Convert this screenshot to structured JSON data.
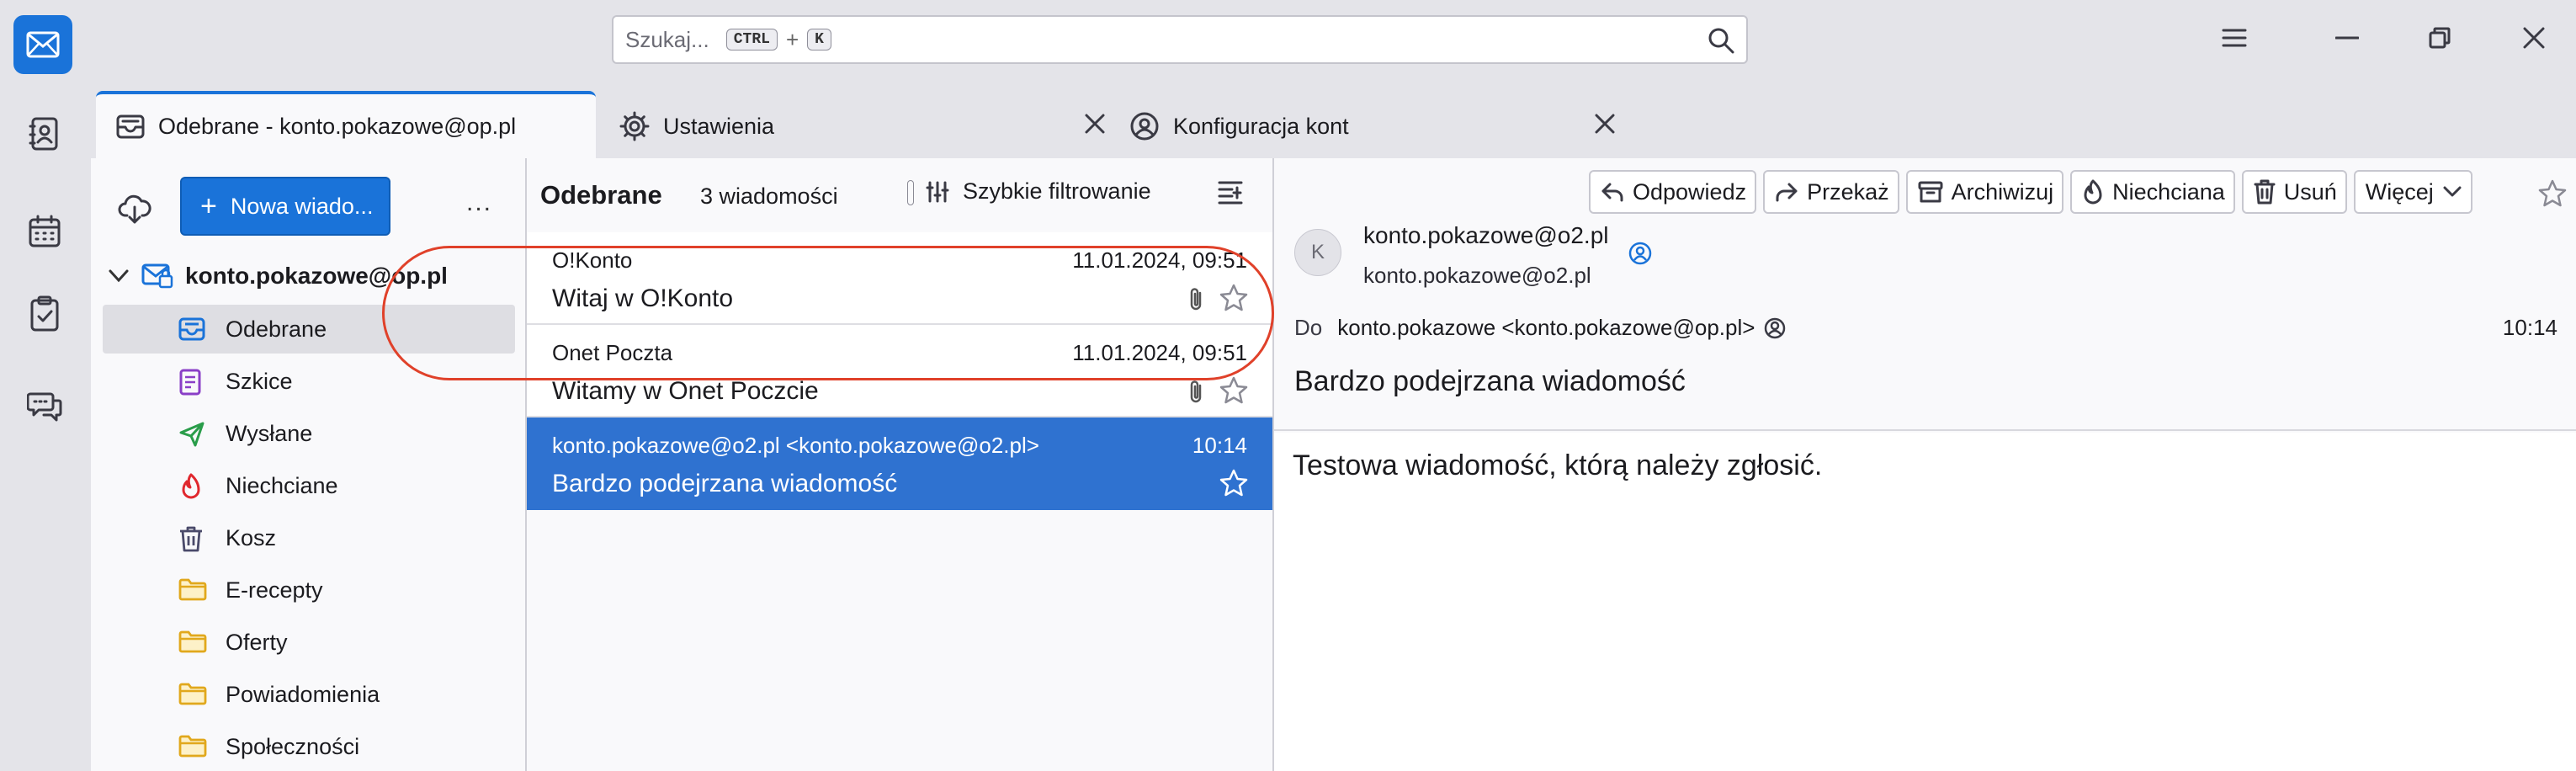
{
  "search": {
    "placeholder": "Szukaj...",
    "key1": "CTRL",
    "plus": "+",
    "key2": "K"
  },
  "tabs": [
    {
      "label": "Odebrane - konto.pokazowe@op.pl"
    },
    {
      "label": "Ustawienia"
    },
    {
      "label": "Konfiguracja kont"
    }
  ],
  "folder_pane": {
    "new_message": "Nowa wiado...",
    "more": "...",
    "account": "konto.pokazowe@op.pl",
    "folders": [
      {
        "label": "Odebrane",
        "icon": "inbox-icon"
      },
      {
        "label": "Szkice",
        "icon": "drafts-icon"
      },
      {
        "label": "Wysłane",
        "icon": "sent-icon"
      },
      {
        "label": "Niechciane",
        "icon": "junk-icon"
      },
      {
        "label": "Kosz",
        "icon": "trash-icon"
      },
      {
        "label": "E-recepty",
        "icon": "folder-icon"
      },
      {
        "label": "Oferty",
        "icon": "folder-icon"
      },
      {
        "label": "Powiadomienia",
        "icon": "folder-icon"
      },
      {
        "label": "Społeczności",
        "icon": "folder-icon"
      }
    ]
  },
  "message_list": {
    "title": "Odebrane",
    "count": "3 wiadomości",
    "quick_filter": "Szybkie filtrowanie",
    "messages": [
      {
        "from": "O!Konto",
        "date": "11.01.2024, 09:51",
        "subject": "Witaj w O!Konto"
      },
      {
        "from": "Onet Poczta",
        "date": "11.01.2024, 09:51",
        "subject": "Witamy w Onet Poczcie"
      },
      {
        "from": "konto.pokazowe@o2.pl <konto.pokazowe@o2.pl>",
        "date": "10:14",
        "subject": "Bardzo podejrzana wiadomość"
      }
    ]
  },
  "message": {
    "actions": {
      "reply": "Odpowiedz",
      "forward": "Przekaż",
      "archive": "Archiwizuj",
      "junk": "Niechciana",
      "delete": "Usuń",
      "more": "Więcej"
    },
    "avatar": "K",
    "from_name": "konto.pokazowe@o2.pl",
    "from_address": "konto.pokazowe@o2.pl",
    "to_label": "Do",
    "to_value": "konto.pokazowe <konto.pokazowe@op.pl>",
    "time": "10:14",
    "subject": "Bardzo podejrzana wiadomość",
    "body": "Testowa wiadomość, którą należy zgłosić."
  },
  "colors": {
    "accent": "#1a73d9",
    "selected_row": "#2f72d0",
    "highlight": "#e0412a"
  }
}
